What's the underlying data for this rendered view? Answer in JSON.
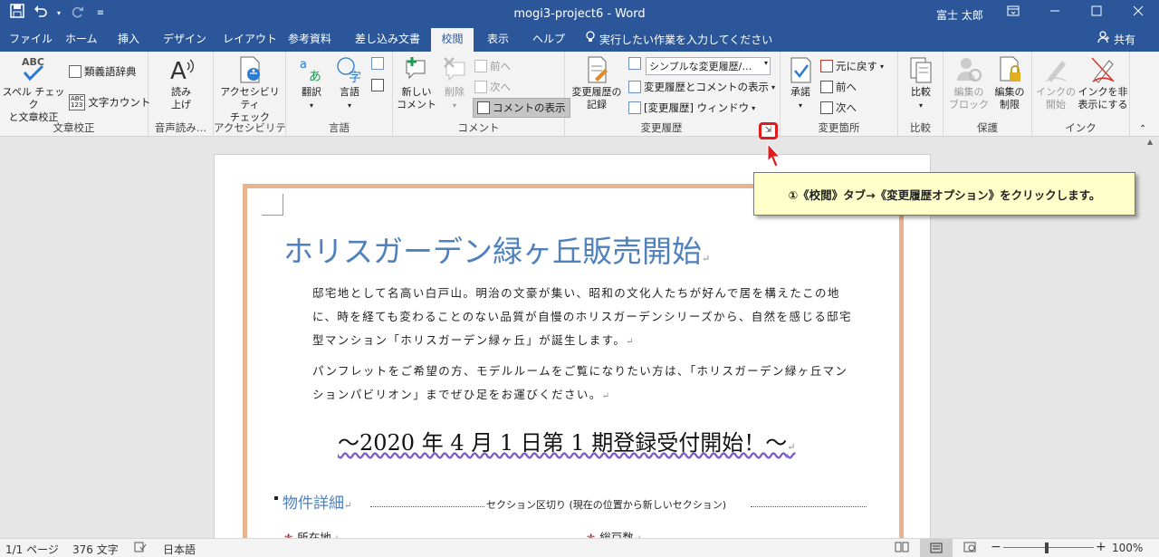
{
  "title_bar": {
    "document_title": "mogi3-project6  -  Word",
    "user": "富士 太郎",
    "icons": [
      "save-icon",
      "undo-icon",
      "redo-icon",
      "customize-qat-icon",
      "ribbon-display-icon",
      "minimize-icon",
      "maximize-icon",
      "close-icon"
    ]
  },
  "tabs": {
    "items": [
      "ファイル",
      "ホーム",
      "挿入",
      "デザイン",
      "レイアウト",
      "参考資料",
      "差し込み文書",
      "校閲",
      "表示",
      "ヘルプ"
    ],
    "active": "校閲",
    "tell_me": "実行したい作業を入力してください",
    "share": "共有"
  },
  "ribbon": {
    "proofing": {
      "label": "文章校正",
      "spell": "スペル チェック\nと文章校正",
      "spell_icon_text": "ABC",
      "thesaurus": "類義語辞典",
      "word_count": "文字カウント",
      "word_count_icon_text": "ABC\n123"
    },
    "speech": {
      "label": "音声読み…",
      "read_aloud": "読み\n上げ"
    },
    "accessibility": {
      "label": "アクセシビリティ",
      "check": "アクセシビリティ\nチェック"
    },
    "language": {
      "label": "言語",
      "translate": "翻訳",
      "language": "言語"
    },
    "comments": {
      "label": "コメント",
      "new": "新しい\nコメント",
      "delete": "削除",
      "prev": "前へ",
      "next": "次へ",
      "show": "コメントの表示"
    },
    "tracking": {
      "label": "変更履歴",
      "track": "変更履歴の\n記録",
      "markup_combo": "シンプルな変更履歴/…",
      "show_markup": "変更履歴とコメントの表示",
      "pane": "[変更履歴] ウィンドウ"
    },
    "changes": {
      "label": "変更箇所",
      "accept": "承諾",
      "reject": "元に戻す",
      "prev": "前へ",
      "next": "次へ"
    },
    "compare": {
      "label": "比較",
      "compare": "比較"
    },
    "protect": {
      "label": "保護",
      "block": "編集の\nブロック",
      "restrict": "編集の\n制限"
    },
    "ink": {
      "label": "インク",
      "start": "インクの\n開始",
      "hide": "インクを非\n表示にする"
    }
  },
  "callout": {
    "text": "①《校閲》タブ→《変更履歴オプション》をクリックします。"
  },
  "document": {
    "heading": "ホリスガーデン緑ヶ丘販売開始",
    "para1_line1": "邸宅地として名高い白戸山。明治の文豪が集い、昭和の文化人たちが好んで居を構えたこの地",
    "para1_line2": "に、時を経ても変わることのない品質が自慢のホリスガーデンシリーズから、自然を感じる邸宅",
    "para1_line3": "型マンション「ホリスガーデン緑ヶ丘」が誕生します。",
    "para2_line1": "パンフレットをご希望の方、モデルルームをご覧になりたい方は、「ホリスガーデン緑ヶ丘マン",
    "para2_line2": "ションパビリオン」までぜひ足をお運びください。",
    "date_line": "～2020 年 4 月 1 日第 1 期登録受付開始！～",
    "section_title": "物件詳細",
    "section_break": "セクション区切り (現在の位置から新しいセクション)",
    "prop_left": "所在地",
    "prop_right": "総戸数",
    "paragraph_mark": "↵"
  },
  "status_bar": {
    "page": "1/1 ページ",
    "words": "376 文字",
    "language": "日本語",
    "zoom": "100%",
    "zoom_minus": "−",
    "zoom_plus": "+"
  },
  "colors": {
    "accent": "#2b579a",
    "heading": "#4f81bd",
    "frame": "#eab38f",
    "highlight": "#e01b1b"
  }
}
